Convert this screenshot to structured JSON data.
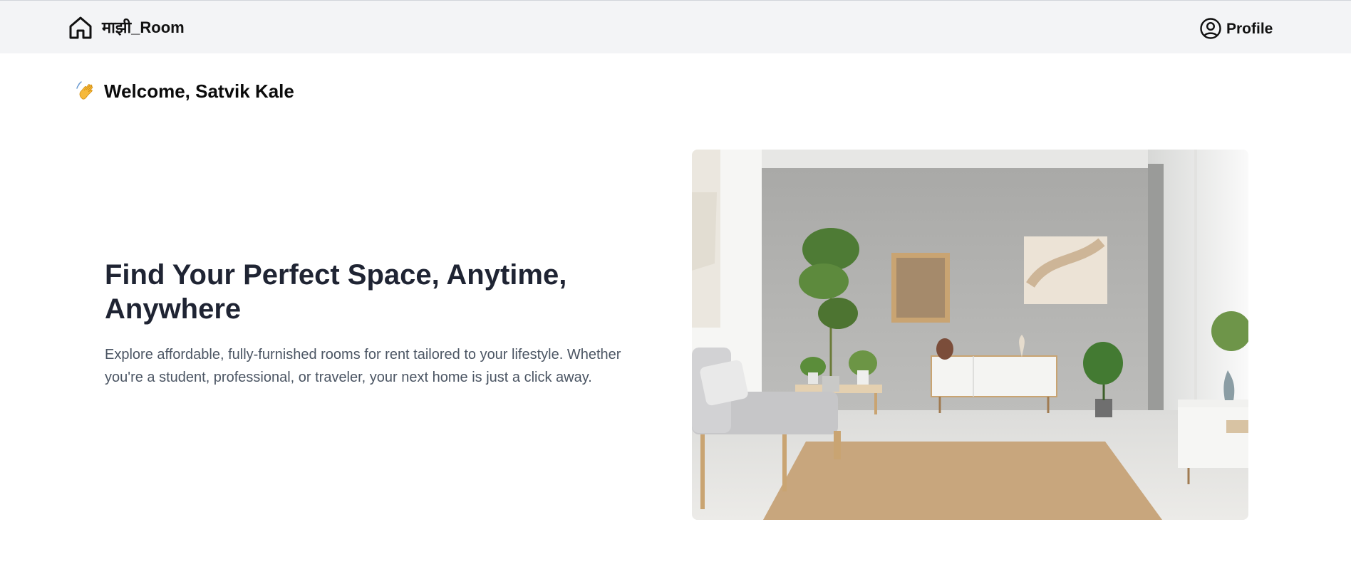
{
  "navbar": {
    "brand": {
      "icon": "home-icon",
      "name": "माझी_Room"
    },
    "profile": {
      "icon": "user-circle-icon",
      "label": "Profile"
    }
  },
  "welcome": {
    "icon": "waving-hand-icon",
    "text": "Welcome, Satvik Kale"
  },
  "hero": {
    "title": "Find Your Perfect Space, Anytime, Anywhere",
    "description": "Explore affordable, fully-furnished rooms for rent tailored to your lifestyle. Whether you're a student, professional, or traveler, your next home is just a click away.",
    "image": "living-room-photo"
  },
  "colors": {
    "navbar_bg": "#f3f4f6",
    "title": "#1f2433",
    "body_text": "#4b5563"
  }
}
